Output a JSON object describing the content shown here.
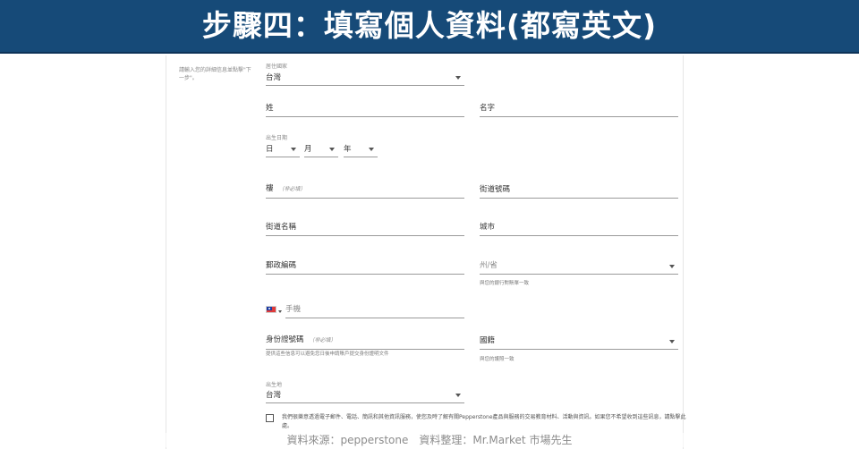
{
  "banner": {
    "title": "步驟四：填寫個人資料(都寫英文)"
  },
  "side_note": "請輸入您的詳細信息並點擊\"下一步\"。",
  "form": {
    "residence_country": {
      "caption": "居住國家",
      "value": "台灣"
    },
    "last_name": {
      "placeholder": "姓"
    },
    "first_name": {
      "placeholder": "名字"
    },
    "birth_date": {
      "caption": "出生日期",
      "day": "日",
      "month": "月",
      "year": "年"
    },
    "floor": {
      "placeholder": "樓",
      "optional": "（非必填）"
    },
    "street_number": {
      "placeholder": "街道號碼"
    },
    "street_name": {
      "placeholder": "街道名稱"
    },
    "city": {
      "placeholder": "城市"
    },
    "postal_code": {
      "placeholder": "郵政編碼"
    },
    "state": {
      "placeholder": "州/省",
      "helper": "與您的銀行對賬單一致"
    },
    "mobile": {
      "placeholder": "手機"
    },
    "id_number": {
      "placeholder": "身份證號碼",
      "optional": "（非必填）",
      "helper": "提供這些信息可以避免您日後申請賬戶提交身份證明文件"
    },
    "nationality": {
      "placeholder": "國籍",
      "helper": "與您的護照一致"
    },
    "birth_place": {
      "caption": "出生地",
      "value": "台灣"
    },
    "consent": {
      "text": "我們很樂意透過電子郵件、電話、簡訊和其他資訊服務，使您及時了解有關Pepperstone產品與服務的交易教育材料、活動與資訊。如果您不希望收到這些訊息，請點擊此處。"
    }
  },
  "credit": "資料來源：pepperstone　資料整理：Mr.Market 市場先生",
  "colors": {
    "banner_bg": "#164a78",
    "banner_text": "#ffffff",
    "field_line": "#9a9a9a",
    "caption_text": "#8a8a8a"
  }
}
